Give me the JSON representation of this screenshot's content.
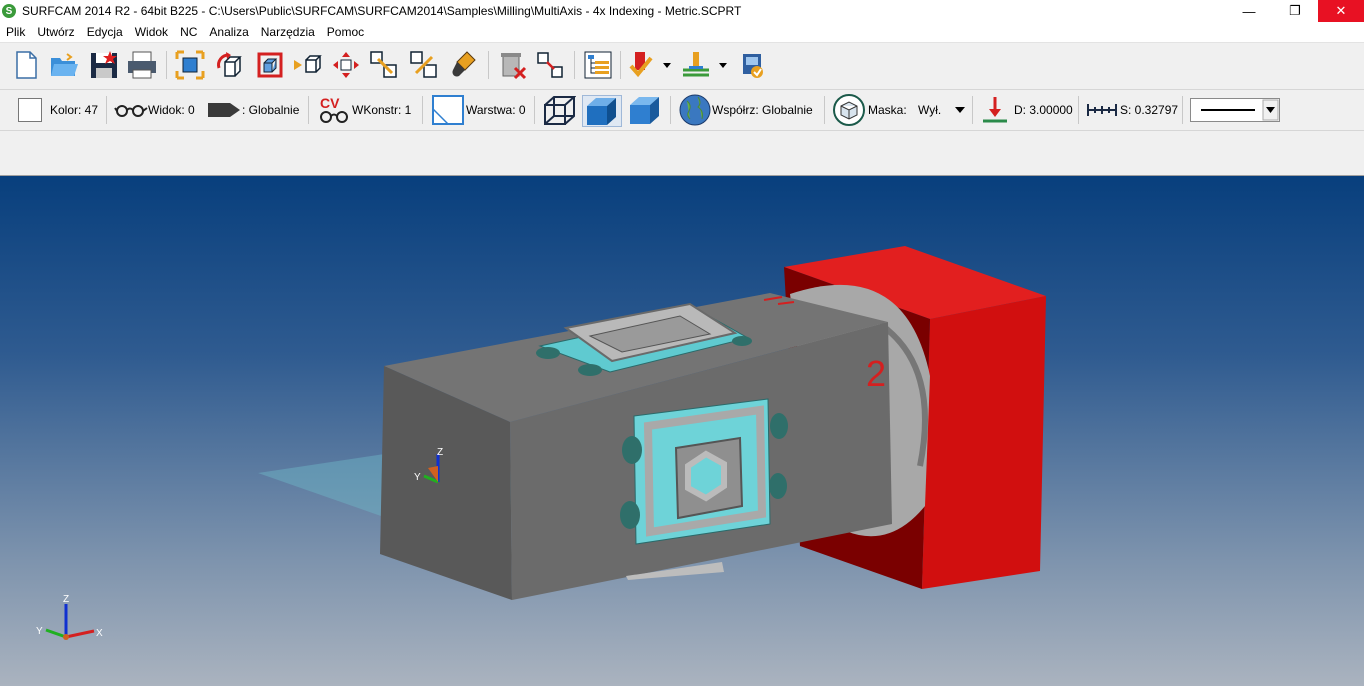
{
  "window": {
    "title": "SURFCAM 2014 R2 - 64bit B225 - C:\\Users\\Public\\SURFCAM\\SURFCAM2014\\Samples\\Milling\\MultiAxis - 4x Indexing - Metric.SCPRT",
    "logo_letter": "S",
    "minimize": "—",
    "restore": "❐",
    "close": "✕"
  },
  "menu": [
    "Plik",
    "Utwórz",
    "Edycja",
    "Widok",
    "NC",
    "Analiza",
    "Narzędzia",
    "Pomoc"
  ],
  "toolbar2": {
    "color_label": "Kolor: 47",
    "view_label": "Widok: 0",
    "view_global": ": Globalnie",
    "cv_text": "CV",
    "cplane_label": "WKonstr: 1",
    "layer_label": "Warstwa: 0",
    "coords_label": "Współrz: Globalnie",
    "mask_label": "Maska:",
    "mask_value": "Wył.",
    "depth_label": "D: 3.00000",
    "scale_label": "S: 0.32797"
  },
  "viewport": {
    "part_label": "2",
    "axis_small": {
      "z": "Z",
      "y": "Y"
    },
    "axis_main": {
      "z": "Z",
      "y": "Y",
      "x": "X"
    }
  }
}
